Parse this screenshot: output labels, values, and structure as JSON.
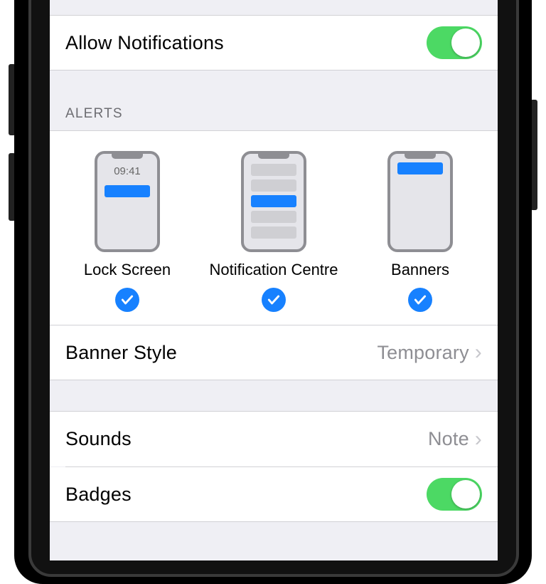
{
  "rows": {
    "allow_notifications": {
      "label": "Allow Notifications",
      "on": true
    },
    "banner_style": {
      "label": "Banner Style",
      "value": "Temporary"
    },
    "sounds": {
      "label": "Sounds",
      "value": "Note"
    },
    "badges": {
      "label": "Badges",
      "on": true
    }
  },
  "sections": {
    "alerts_header": "ALERTS"
  },
  "alerts": {
    "preview_time": "09:41",
    "options": [
      {
        "label": "Lock Screen",
        "checked": true
      },
      {
        "label": "Notification Centre",
        "checked": true
      },
      {
        "label": "Banners",
        "checked": true
      }
    ]
  },
  "colors": {
    "switch_on": "#4cd964",
    "accent_blue": "#1781ff"
  }
}
